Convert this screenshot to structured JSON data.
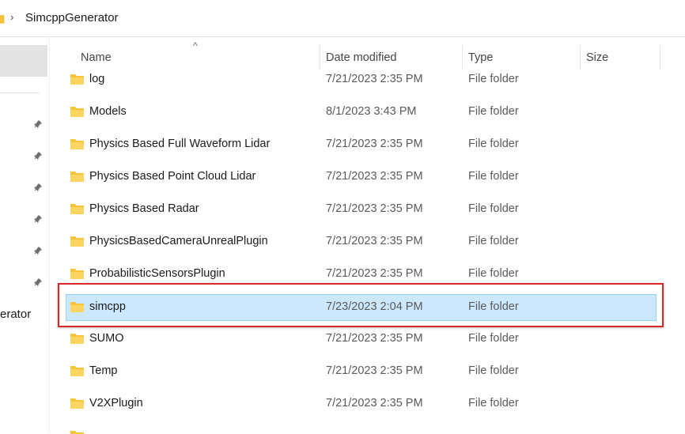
{
  "address": {
    "path_segment": "SimcppGenerator"
  },
  "nav": {
    "partial_label": "erator",
    "pins": [
      "pin-icon",
      "pin-icon",
      "pin-icon",
      "pin-icon",
      "pin-icon",
      "pin-icon"
    ]
  },
  "columns": {
    "name": "Name",
    "date": "Date modified",
    "type": "Type",
    "size": "Size"
  },
  "sort_indicator": "^",
  "rows": [
    {
      "name": "log",
      "date": "7/21/2023 2:35 PM",
      "type": "File folder",
      "selected": false
    },
    {
      "name": "Models",
      "date": "8/1/2023 3:43 PM",
      "type": "File folder",
      "selected": false
    },
    {
      "name": "Physics Based Full Waveform Lidar",
      "date": "7/21/2023 2:35 PM",
      "type": "File folder",
      "selected": false
    },
    {
      "name": "Physics Based Point Cloud Lidar",
      "date": "7/21/2023 2:35 PM",
      "type": "File folder",
      "selected": false
    },
    {
      "name": "Physics Based Radar",
      "date": "7/21/2023 2:35 PM",
      "type": "File folder",
      "selected": false
    },
    {
      "name": "PhysicsBasedCameraUnrealPlugin",
      "date": "7/21/2023 2:35 PM",
      "type": "File folder",
      "selected": false
    },
    {
      "name": "ProbabilisticSensorsPlugin",
      "date": "7/21/2023 2:35 PM",
      "type": "File folder",
      "selected": false
    },
    {
      "name": "simcpp",
      "date": "7/23/2023 2:04 PM",
      "type": "File folder",
      "selected": true
    },
    {
      "name": "SUMO",
      "date": "7/21/2023 2:35 PM",
      "type": "File folder",
      "selected": false
    },
    {
      "name": "Temp",
      "date": "7/21/2023 2:35 PM",
      "type": "File folder",
      "selected": false
    },
    {
      "name": "V2XPlugin",
      "date": "7/21/2023 2:35 PM",
      "type": "File folder",
      "selected": false
    }
  ],
  "colors": {
    "folder": "#f8c43a",
    "selection_bg": "#cce8ff",
    "selection_border": "#99d1ff",
    "annotation_box": "#d9262b"
  }
}
